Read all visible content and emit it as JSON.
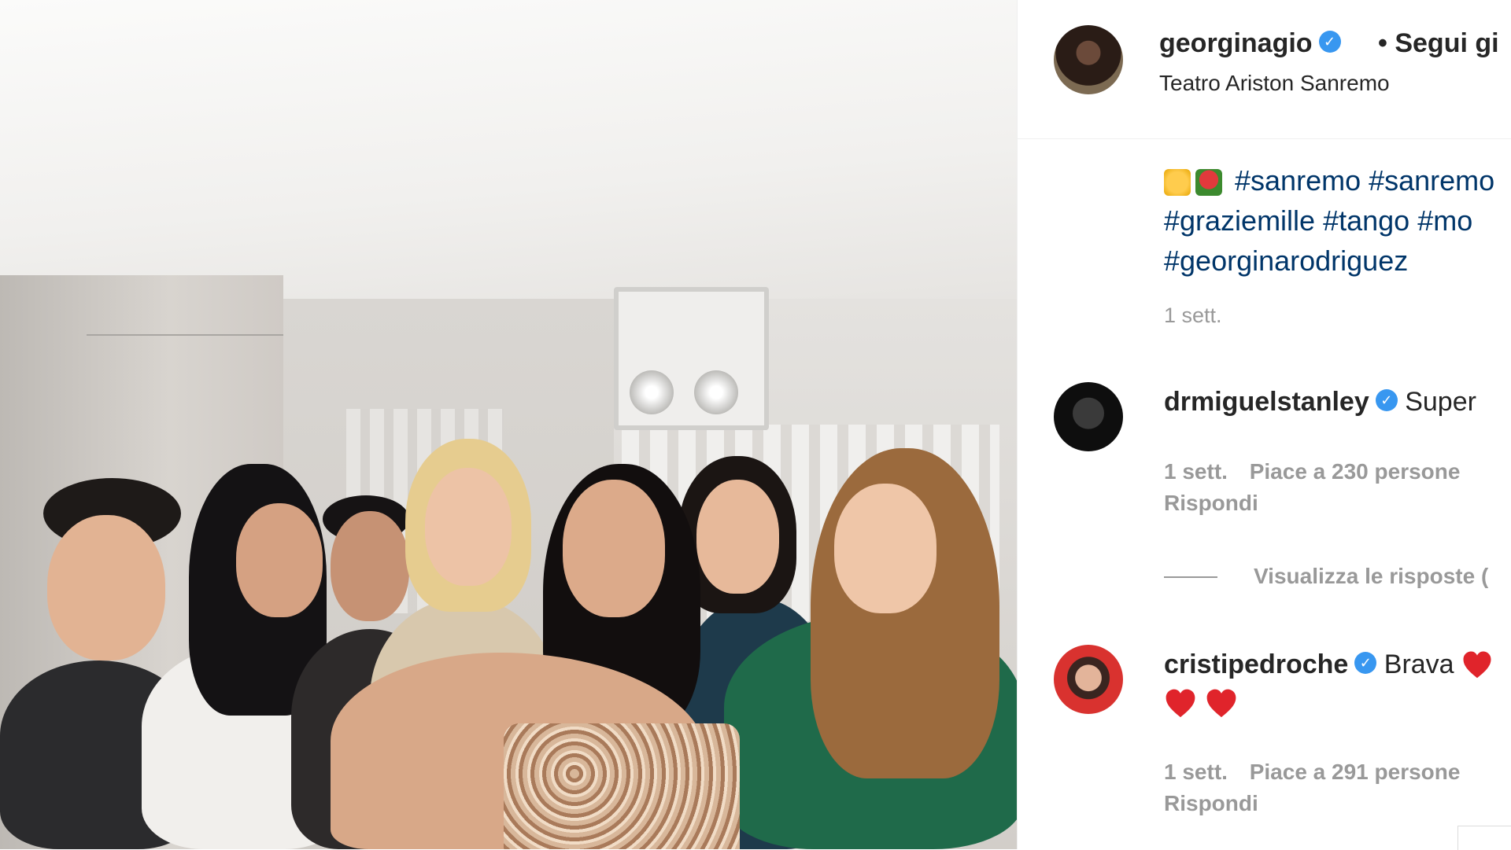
{
  "post": {
    "username": "georginagio",
    "follow_label": "• Segui gi",
    "location": "Teatro Ariston Sanremo",
    "caption_lines": [
      "#sanremo #sanremo",
      "#graziemille #tango #mo",
      "#georginarodriguez"
    ],
    "caption_time": "1 sett."
  },
  "comments": [
    {
      "username": "drmiguelstanley",
      "text": "Super",
      "time": "1 sett.",
      "likes": "Piace a 230 persone",
      "reply": "Rispondi",
      "view_replies": "Visualizza le risposte ("
    },
    {
      "username": "cristipedroche",
      "text": "Brava",
      "time": "1 sett.",
      "likes": "Piace a 291 persone",
      "reply": "Rispondi"
    }
  ],
  "icons": {
    "verified": "verified-badge-icon",
    "emoji_pray": "folded-hands-emoji",
    "emoji_rose": "rose-emoji",
    "heart": "red-heart-emoji"
  },
  "colors": {
    "link": "#003569",
    "verified": "#3897f0",
    "muted": "#999999",
    "heart": "#ed1c24"
  }
}
